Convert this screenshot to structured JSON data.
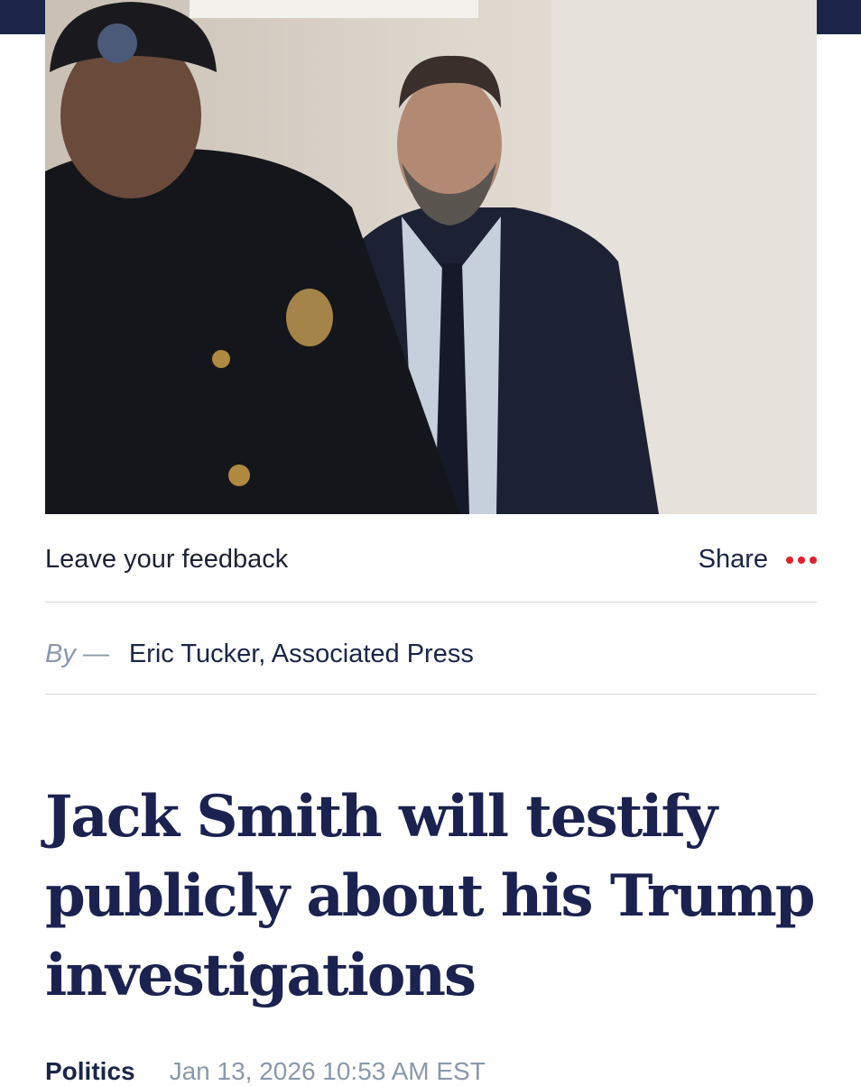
{
  "photo": {
    "description_icon": "news-photo"
  },
  "feedback": {
    "label": "Leave your feedback"
  },
  "share": {
    "label": "Share",
    "more_icon": "more-dots-icon"
  },
  "byline": {
    "prefix": "By",
    "dash": "—",
    "author": "Eric Tucker, Associated Press"
  },
  "headline": "Jack Smith will testify publicly about his Trump investigations",
  "meta": {
    "category": "Politics",
    "date": "Jan 13, 2026 10:53 AM EST"
  },
  "colors": {
    "navy": "#1b2548",
    "accent_red": "#e0202c",
    "muted": "#8a98aa"
  }
}
